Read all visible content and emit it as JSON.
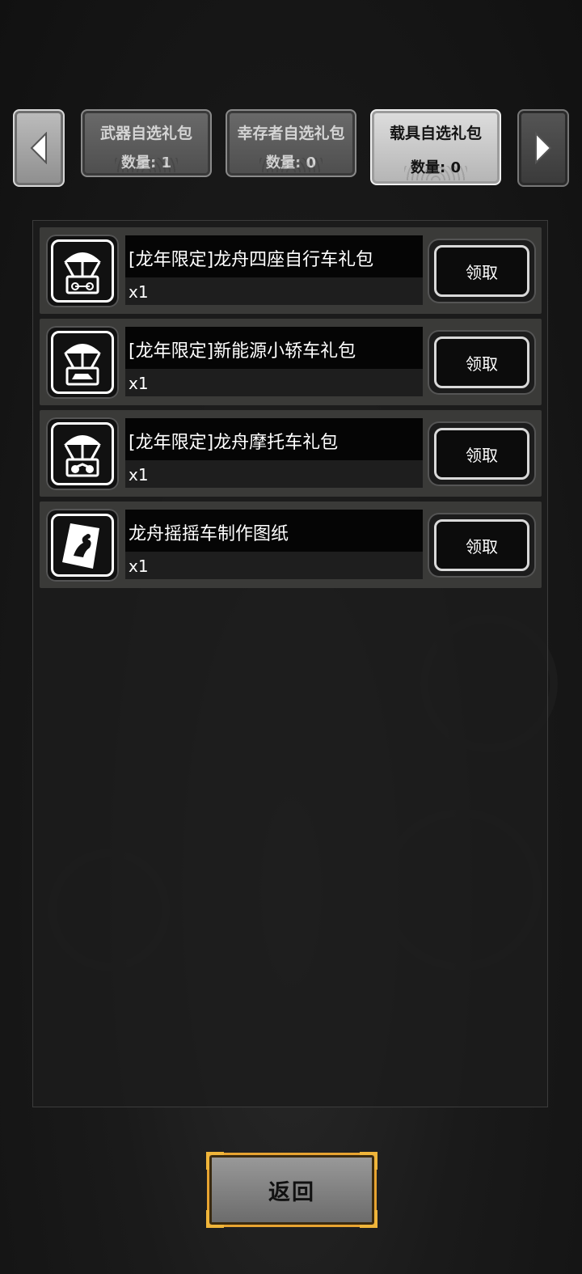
{
  "tabs": [
    {
      "name": "武器自选礼包",
      "count": "数量: 1",
      "active": false
    },
    {
      "name": "幸存者自选礼包",
      "count": "数量: 0",
      "active": false
    },
    {
      "name": "载具自选礼包",
      "count": "数量: 0",
      "active": true
    }
  ],
  "items": [
    {
      "name": "[龙年限定]龙舟四座自行车礼包",
      "qty": "x1",
      "icon": "airdrop-bicycle-icon",
      "claim": "领取"
    },
    {
      "name": "[龙年限定]新能源小轿车礼包",
      "qty": "x1",
      "icon": "airdrop-car-icon",
      "claim": "领取"
    },
    {
      "name": "[龙年限定]龙舟摩托车礼包",
      "qty": "x1",
      "icon": "airdrop-motorcycle-icon",
      "claim": "领取"
    },
    {
      "name": "龙舟摇摇车制作图纸",
      "qty": "x1",
      "icon": "blueprint-icon",
      "claim": "领取"
    }
  ],
  "footer": {
    "back_label": "返回"
  },
  "colors": {
    "accent_gold": "#e8a431",
    "tab_active": "#d0d0d0",
    "row_bg": "#3a3a38"
  }
}
